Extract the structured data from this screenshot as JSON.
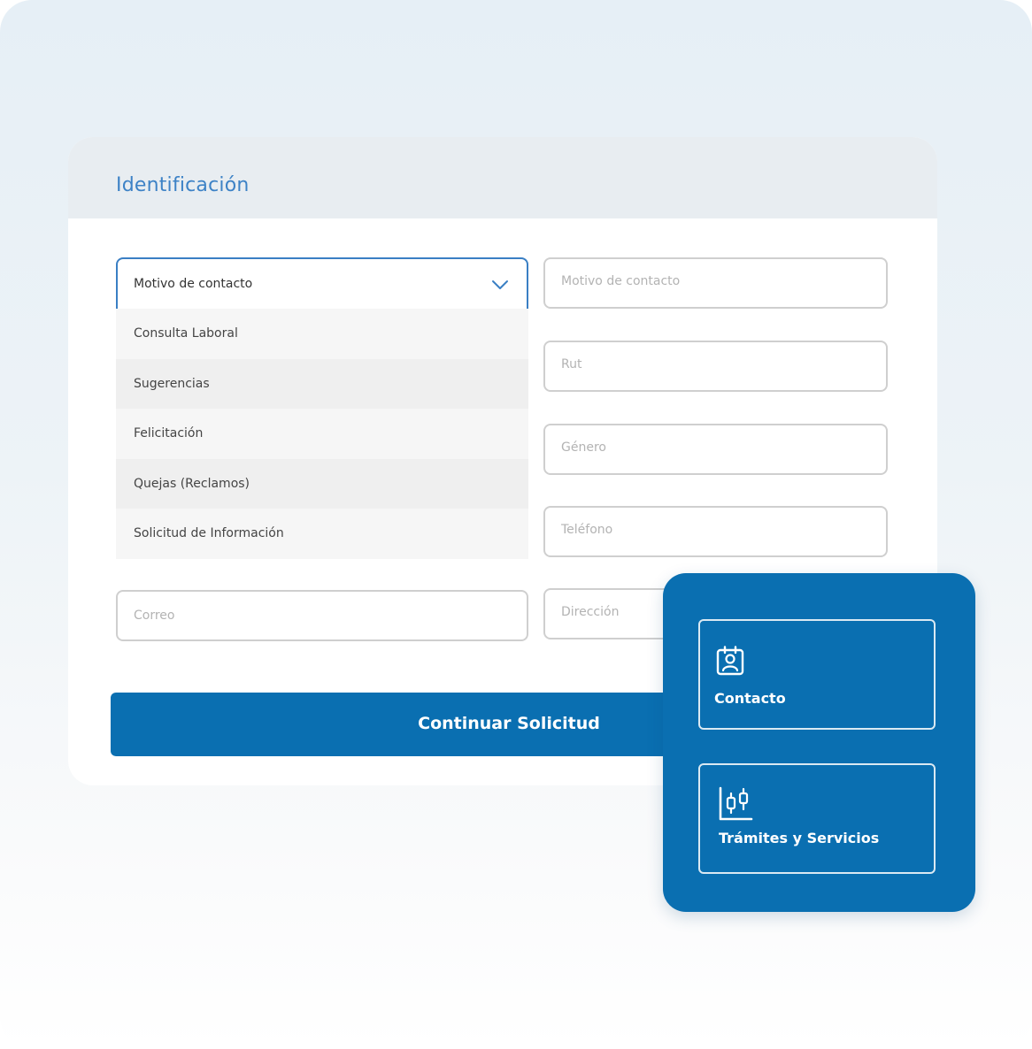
{
  "form": {
    "title": "Identificación",
    "select": {
      "label": "Motivo de contacto",
      "options": [
        "Consulta Laboral",
        "Sugerencias",
        "Felicitación",
        "Quejas (Reclamos)",
        "Solicitud de Información"
      ]
    },
    "fields": {
      "motivo": "Motivo de contacto",
      "rut": "Rut",
      "genero": "Género",
      "telefono": "Teléfono",
      "correo": "Correo",
      "direccion": "Dirección"
    },
    "submit_label": "Continuar Solicitud"
  },
  "panel": {
    "tiles": [
      {
        "label": "Contacto",
        "icon": "contact-card-icon"
      },
      {
        "label": "Trámites y Servicios",
        "icon": "chart-icon"
      }
    ]
  },
  "colors": {
    "accent": "#0a6fb1",
    "title": "#3d82c6",
    "select_border": "#3a7fc4"
  }
}
